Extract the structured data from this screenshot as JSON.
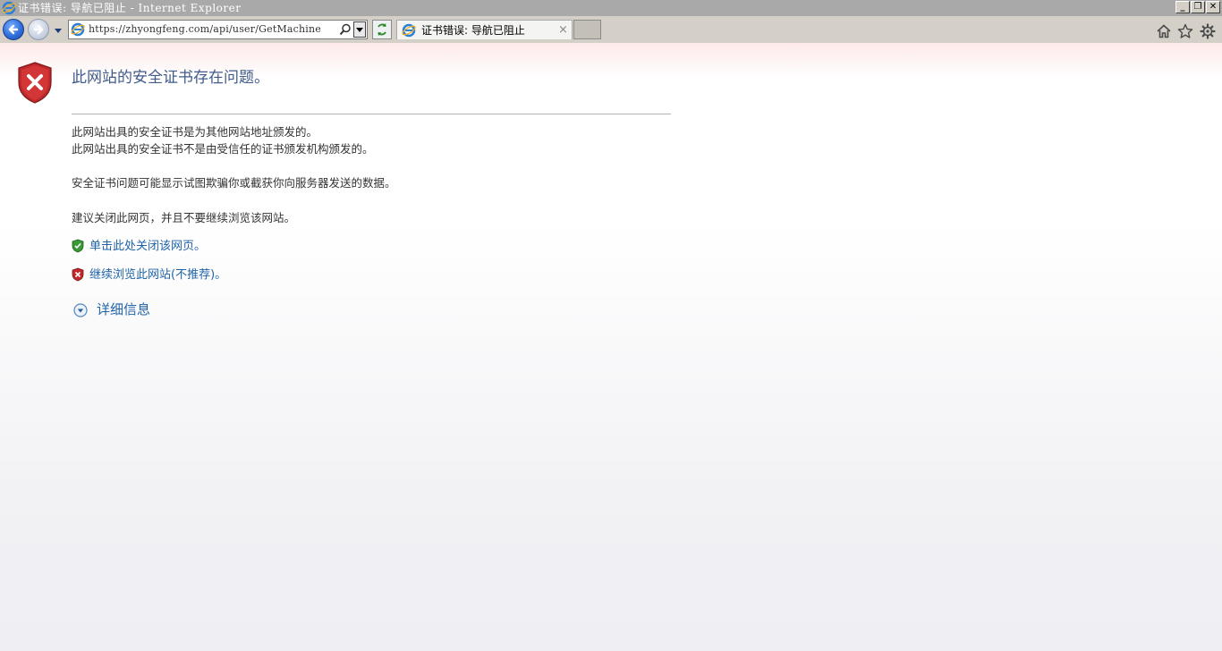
{
  "window": {
    "title": "证书错误: 导航已阻止 - Internet Explorer",
    "minimize_label": "_",
    "restore_label": "❐",
    "close_label": "✕"
  },
  "navbar": {
    "url": "https://zhyongfeng.com/api/user/GetMachine",
    "tab_title": "证书错误: 导航已阻止",
    "tab_close_label": "×"
  },
  "page": {
    "headline": "此网站的安全证书存在问题。",
    "paragraphs": [
      "此网站出具的安全证书是为其他网站地址颁发的。",
      "此网站出具的安全证书不是由受信任的证书颁发机构颁发的。",
      "安全证书问题可能显示试图欺骗你或截获你向服务器发送的数据。",
      "建议关闭此网页，并且不要继续浏览该网站。"
    ],
    "close_link": "单击此处关闭该网页。",
    "continue_link": "继续浏览此网站(不推荐)。",
    "more_info": "详细信息"
  },
  "icons": {
    "back": "back-arrow-icon",
    "forward": "forward-arrow-icon",
    "home": "home-icon",
    "favorites": "star-icon",
    "tools": "gear-icon"
  },
  "colors": {
    "headline": "#3f5c8a",
    "link": "#1f63a8",
    "danger_shield": "#c0282b",
    "safe_shield": "#3a9a3a"
  }
}
